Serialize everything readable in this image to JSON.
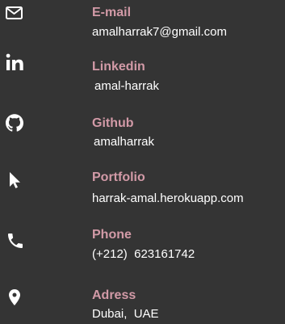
{
  "accent": "#d29aa7",
  "contacts": [
    {
      "icon": "envelope-icon",
      "label": "E-mail",
      "value": "amalharrak7@gmail.com"
    },
    {
      "icon": "linkedin-icon",
      "label": "Linkedin",
      "value": "amal-harrak"
    },
    {
      "icon": "github-icon",
      "label": "Github",
      "value": "amalharrak"
    },
    {
      "icon": "cursor-pointer-icon",
      "label": "Portfolio",
      "value": "harrak-amal.herokuapp.com"
    },
    {
      "icon": "phone-icon",
      "label": "Phone",
      "value": "(+212)  623161742"
    },
    {
      "icon": "map-marker-icon",
      "label": "Adress",
      "value": "Dubai,  UAE"
    }
  ]
}
